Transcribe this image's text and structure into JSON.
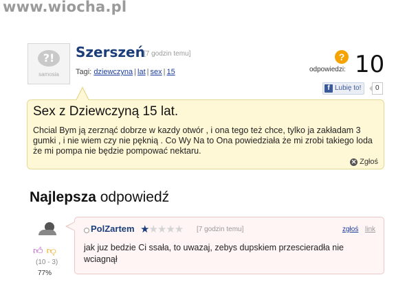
{
  "watermark": "www.wiocha.pl",
  "question": {
    "avatar_logo": "samosia",
    "user": "Szerszeń",
    "time": "[7 godzin temu]",
    "tags_label": "Tagi:",
    "tags": [
      "dziewczyna",
      "lat",
      "sex",
      "15"
    ],
    "answers_label": "odpowiedzi:",
    "answers_count": "10",
    "like_label": "Lubię to!",
    "like_count": "0",
    "title": "Sex z Dziewczyną 15 lat.",
    "text": "Chcial Bym ją zerznąć dobrze w kazdy otwór , i ona tego też chce, tylko ja zakładam 3 gumki , i nie wiem czy nie pęknią . Co Wy Na to Ona powiedziała że mi zrobi takiego loda że mi pompa nie będzie pompować nektaru.",
    "report_label": "Zgłoś"
  },
  "best_answer": {
    "heading_bold": "Najlepsza",
    "heading_rest": " odpowiedź",
    "user": "PolZartem",
    "stars_on": "★",
    "stars_off": "★★★★",
    "time": "[7 godzin temu]",
    "report_label": "zgłoś",
    "link_label": "link",
    "text": "jak juz bedzie Ci ssała, to uwazaj, zebys dupskiem przescieradła nie wciagnął",
    "votes": "(10 - 3)",
    "percent": "77%"
  },
  "icons": {
    "question": "question-mark-icon",
    "facebook": "facebook-icon",
    "close": "close-icon",
    "thumb_up": "thumbs-up-icon",
    "thumb_down": "thumbs-down-icon"
  },
  "colors": {
    "question_bg": "#fff8d6",
    "answer_bg": "#fff5f5",
    "username": "#1b3e7a",
    "warning": "#f5a300"
  }
}
